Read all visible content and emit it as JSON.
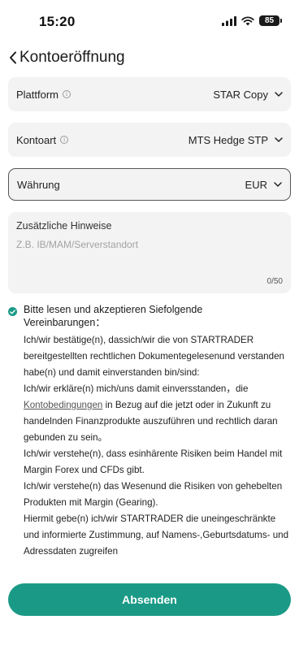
{
  "status_bar": {
    "time": "15:20",
    "battery": "85"
  },
  "header": {
    "title": "Kontoeröffnung"
  },
  "fields": {
    "plattform": {
      "label": "Plattform",
      "value": "STAR Copy"
    },
    "kontoart": {
      "label": "Kontoart",
      "value": "MTS Hedge STP"
    },
    "waehrung": {
      "label": "Währung",
      "value": "EUR"
    }
  },
  "notes": {
    "label": "Zusätzliche Hinweise",
    "placeholder": "Z.B. IB/MAM/Serverstandort",
    "counter": "0/50"
  },
  "agreement": {
    "checked": true,
    "title": "Bitte lesen und akzeptieren Siefolgende Vereinbarungen：",
    "para1": "Ich/wir bestätige(n), dassich/wir die von STARTRADER bereitgestellten rechtlichen Dokumentegelesenund verstanden habe(n) und damit einverstanden bin/sind:",
    "para2_before": "Ich/wir erkläre(n) mich/uns damit einversstanden，die ",
    "para2_link": "Kontobedingungen",
    "para2_after": " in Bezug auf die jetzt oder in Zukunft zu handelnden Finanzprodukte auszuführen und rechtlich daran gebunden zu sein。",
    "para3": "Ich/wir verstehe(n), dass esinhärente Risiken beim Handel mit Margin Forex und CFDs gibt.",
    "para4": "Ich/wir verstehe(n) das Wesenund die Risiken von gehebelten Produkten mit Margin (Gearing).",
    "para5": "Hiermit gebe(n) ich/wir STARTRADER die uneingeschränkte und informierte Zustimmung, auf Namens-,Geburtsdatums- und Adressdaten zugreifen"
  },
  "submit_label": "Absenden",
  "colors": {
    "accent": "#1a9a86",
    "field_bg": "#f3f3f3"
  }
}
